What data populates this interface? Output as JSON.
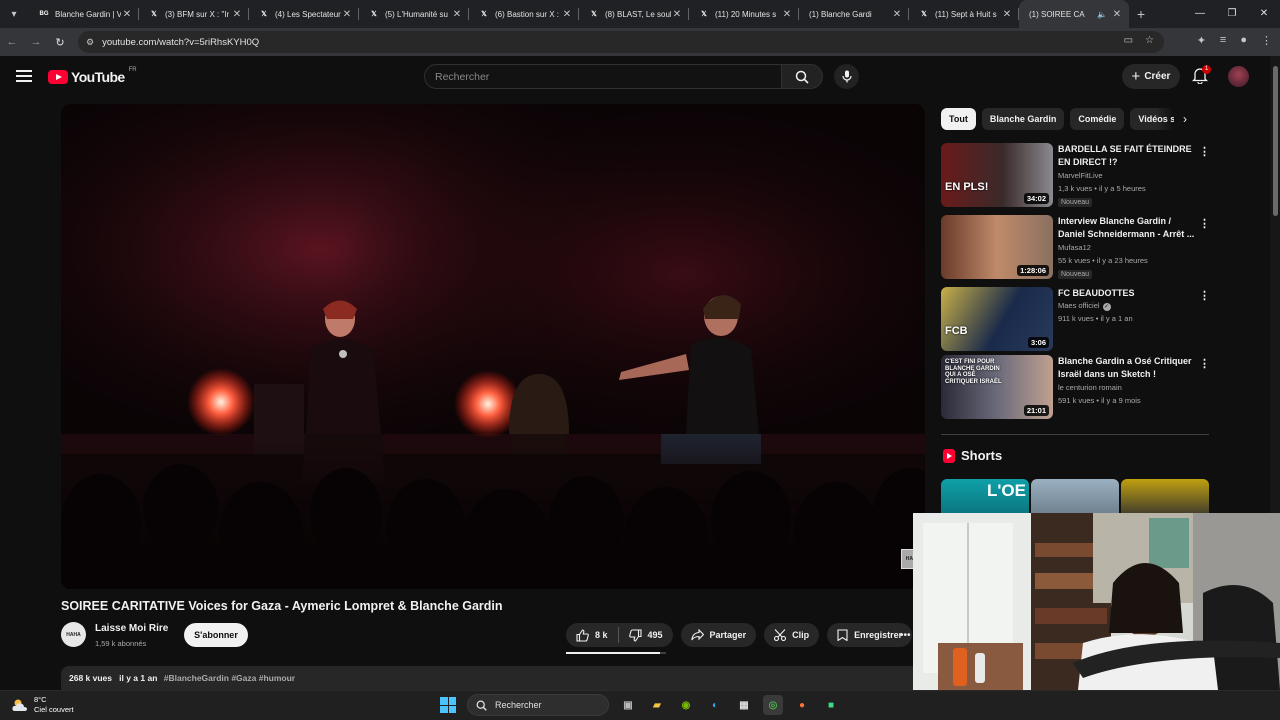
{
  "browser": {
    "tabs": [
      {
        "label": "Blanche Gardin | V",
        "favicon": "bg"
      },
      {
        "label": "(3) BFM sur X : \"Ir",
        "favicon": "x"
      },
      {
        "label": "(4) Les Spectateur",
        "favicon": "x"
      },
      {
        "label": "(5) L'Humanité su",
        "favicon": "x"
      },
      {
        "label": "(6) Bastion sur X :",
        "favicon": "x"
      },
      {
        "label": "(8) BLAST, Le soul",
        "favicon": "x"
      },
      {
        "label": "(11) 20 Minutes s",
        "favicon": "x"
      },
      {
        "label": "(1) Blanche Gardi",
        "favicon": "yt"
      },
      {
        "label": "(11) Sept à Huit s",
        "favicon": "x"
      },
      {
        "label": "(1) SOIREE CA",
        "favicon": "yt",
        "active": true
      }
    ],
    "url": "youtube.com/watch?v=5riRhsKYH0Q"
  },
  "youtube": {
    "logo_text": "YouTube",
    "country_code": "FR",
    "search_placeholder": "Rechercher",
    "create_label": "Créer",
    "notif_count": "1"
  },
  "video": {
    "title": "SOIREE CARITATIVE Voices for Gaza - Aymeric Lompret & Blanche Gardin",
    "channel_name": "Laisse Moi Rire",
    "channel_avatar_text": "HAHA",
    "subscribers": "1,59 k abonnés",
    "subscribe_label": "S'abonner",
    "likes": "8 k",
    "dislikes": "495",
    "like_ratio": 0.94,
    "share_label": "Partager",
    "clip_label": "Clip",
    "save_label": "Enregistrer",
    "views": "268 k vues",
    "age": "il y a 1 an",
    "hashtags": "#BlancheGardin #Gaza #humour",
    "watermark": "HAHA"
  },
  "chips": [
    "Tout",
    "Blanche Gardin",
    "Comédie",
    "Vidéos su"
  ],
  "recommendations": [
    {
      "title": "BARDELLA SE FAIT ÉTEINDRE EN DIRECT !?",
      "channel": "MarvelFitLive",
      "meta": "1,3 k vues • il y a 5 heures",
      "duration": "34:02",
      "badge": "Nouveau",
      "thumb_text": "EN PLS!"
    },
    {
      "title": "Interview Blanche Gardin / Daniel Schneidermann - Arrêt ...",
      "channel": "Mufasa12",
      "meta": "55 k vues • il y a 23 heures",
      "duration": "1:28:06",
      "badge": "Nouveau",
      "thumb_text": ""
    },
    {
      "title": "FC BEAUDOTTES",
      "channel": "Maes officiel",
      "verified": true,
      "meta": "911 k vues • il y a 1 an",
      "duration": "3:06",
      "badge": "",
      "thumb_text": "FCB"
    },
    {
      "title": "Blanche Gardin a Osé Critiquer Israël dans un Sketch !",
      "channel": "le centurion romain",
      "meta": "591 k vues • il y a 9 mois",
      "duration": "21:01",
      "badge": "",
      "thumb_text": "C'EST FINI POUR BLANCHE GARDIN QUI A OSÉ CRITIQUER ISRAËL"
    }
  ],
  "shorts": {
    "title": "Shorts",
    "first_text": "L'OE"
  },
  "taskbar": {
    "temperature": "8°C",
    "weather": "Ciel couvert",
    "search_label": "Rechercher"
  }
}
